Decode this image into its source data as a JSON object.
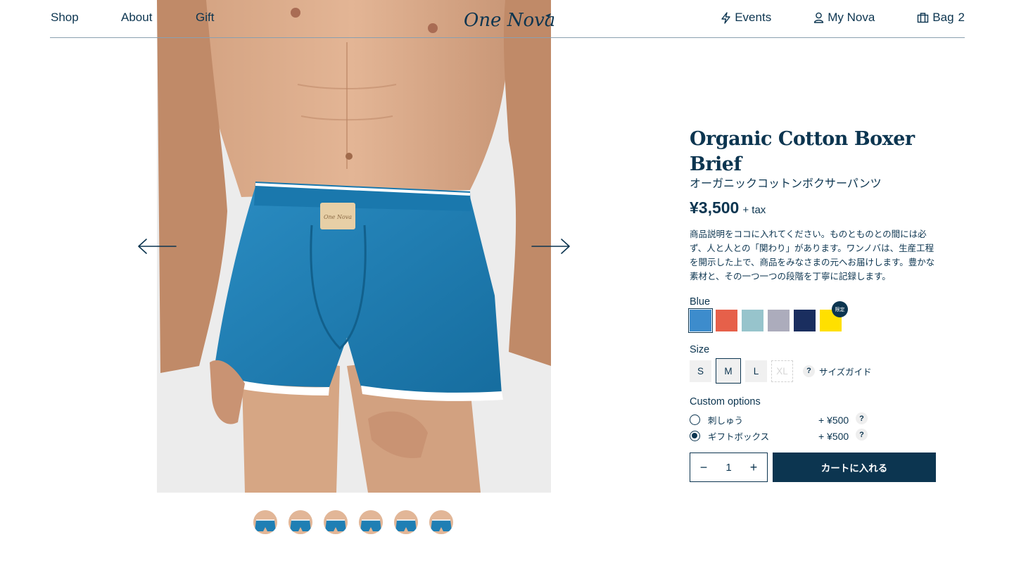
{
  "header": {
    "nav_left": [
      "Shop",
      "About",
      "Gift"
    ],
    "logo_text": "One Nova",
    "events_label": "Events",
    "my_nova_label": "My Nova",
    "bag_label": "Bag",
    "bag_count": "2"
  },
  "gallery": {
    "thumbnail_count": 6,
    "prev_icon": "arrow-left-icon",
    "next_icon": "arrow-right-icon"
  },
  "product": {
    "title": "Organic Cotton Boxer Brief",
    "subtitle": "オーガニックコットンボクサーパンツ",
    "price": "¥3,500",
    "tax": "+ tax",
    "description": "商品説明をココに入れてください。ものとものとの間には必ず、人と人との「関わり」があります。ワンノバは、生産工程を開示した上で、商品をみなさまの元へお届けします。豊かな素材と、その一つ一つの段階を丁寧に記録します。",
    "waistband_label": "One Nova"
  },
  "color": {
    "selected_label": "Blue",
    "swatches": [
      "#3d8ccc",
      "#e6604a",
      "#97c4cc",
      "#acacbc",
      "#1a2e5f",
      "#ffe000"
    ],
    "limited_badge": "限定"
  },
  "size": {
    "label": "Size",
    "options": [
      "S",
      "M",
      "L",
      "XL"
    ],
    "selected": "M",
    "disabled": "XL",
    "guide_icon": "?",
    "guide_label": "サイズガイド"
  },
  "custom_options": {
    "label": "Custom options",
    "items": [
      {
        "name": "刺しゅう",
        "price": "+ ¥500",
        "checked": false
      },
      {
        "name": "ギフトボックス",
        "price": "+ ¥500",
        "checked": true
      }
    ],
    "help_icon": "?"
  },
  "cart": {
    "minus": "−",
    "quantity": "1",
    "plus": "+",
    "button_label": "カートに入れる"
  },
  "colors": {
    "primary": "#0c3550",
    "product_blue": "#1f7fb4"
  }
}
